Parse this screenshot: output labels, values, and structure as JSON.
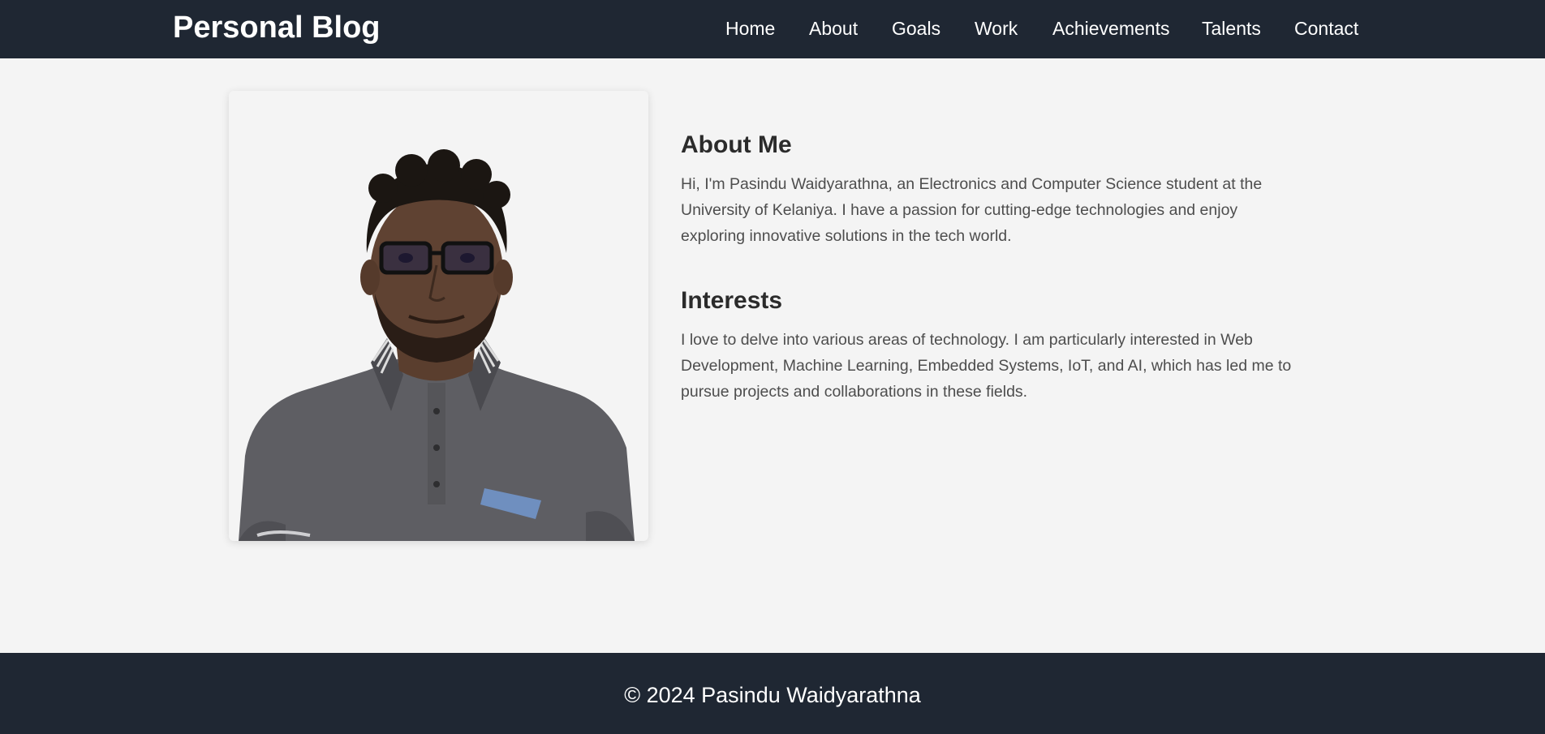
{
  "header": {
    "brand": "Personal Blog",
    "nav": [
      {
        "label": "Home"
      },
      {
        "label": "About"
      },
      {
        "label": "Goals"
      },
      {
        "label": "Work"
      },
      {
        "label": "Achievements"
      },
      {
        "label": "Talents"
      },
      {
        "label": "Contact"
      }
    ]
  },
  "main": {
    "about": {
      "title": "About Me",
      "body": "Hi, I'm Pasindu Waidyarathna, an Electronics and Computer Science student at the University of Kelaniya. I have a passion for cutting-edge technologies and enjoy exploring innovative solutions in the tech world."
    },
    "interests": {
      "title": "Interests",
      "body": "I love to delve into various areas of technology. I am particularly interested in Web Development, Machine Learning, Embedded Systems, IoT, and AI, which has led me to pursue projects and collaborations in these fields."
    }
  },
  "footer": {
    "copyright": "© 2024 Pasindu Waidyarathna"
  },
  "colors": {
    "nav_bg": "#1f2733",
    "page_bg": "#f4f4f4",
    "heading": "#2b2b2b",
    "body_text": "#4d4d4d"
  }
}
